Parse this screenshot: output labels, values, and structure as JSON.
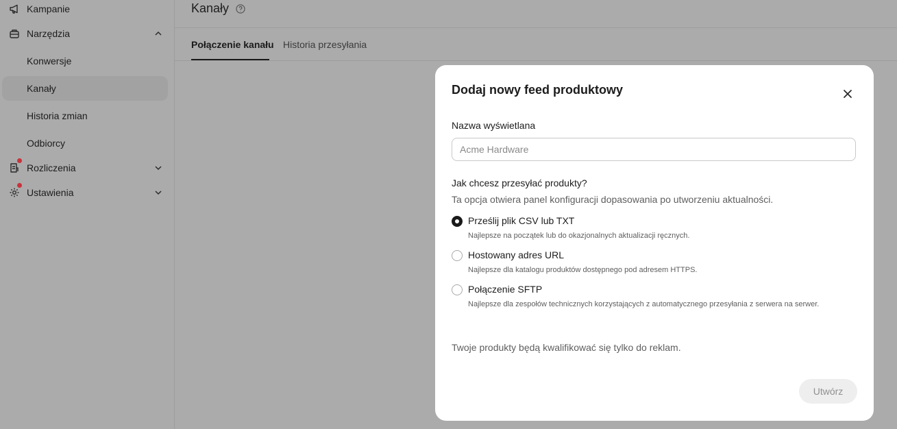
{
  "sidebar": {
    "items": [
      {
        "label": "Kampanie",
        "icon": "megaphone-icon"
      },
      {
        "label": "Narzędzia",
        "icon": "tools-icon"
      },
      {
        "label": "Konwersje"
      },
      {
        "label": "Kanały"
      },
      {
        "label": "Historia zmian"
      },
      {
        "label": "Odbiorcy"
      },
      {
        "label": "Rozliczenia",
        "icon": "billing-icon"
      },
      {
        "label": "Ustawienia",
        "icon": "settings-icon"
      }
    ]
  },
  "page": {
    "title": "Kanały",
    "tabs": [
      {
        "label": "Połączenie kanału"
      },
      {
        "label": "Historia przesyłania"
      }
    ]
  },
  "modal": {
    "title": "Dodaj nowy feed produktowy",
    "name_label": "Nazwa wyświetlana",
    "name_placeholder": "Acme Hardware",
    "question": "Jak chcesz przesyłać produkty?",
    "question_desc": "Ta opcja otwiera panel konfiguracji dopasowania po utworzeniu aktualności.",
    "options": [
      {
        "title": "Prześlij plik CSV lub TXT",
        "desc": "Najlepsze na początek lub do okazjonalnych aktualizacji ręcznych.",
        "selected": true
      },
      {
        "title": "Hostowany adres URL",
        "desc": "Najlepsze dla katalogu produktów dostępnego pod adresem HTTPS.",
        "selected": false
      },
      {
        "title": "Połączenie SFTP",
        "desc": "Najlepsze dla zespołów technicznych korzystających z automatycznego przesyłania z serwera na serwer.",
        "selected": false
      }
    ],
    "note": "Twoje produkty będą kwalifikować się tylko do reklam.",
    "create_label": "Utwórz"
  },
  "colors": {
    "overlay_bg": "#ababab",
    "notification_dot": "#c9323c",
    "modal_bg": "#ffffff",
    "disabled_button_bg": "#eeeeee"
  }
}
